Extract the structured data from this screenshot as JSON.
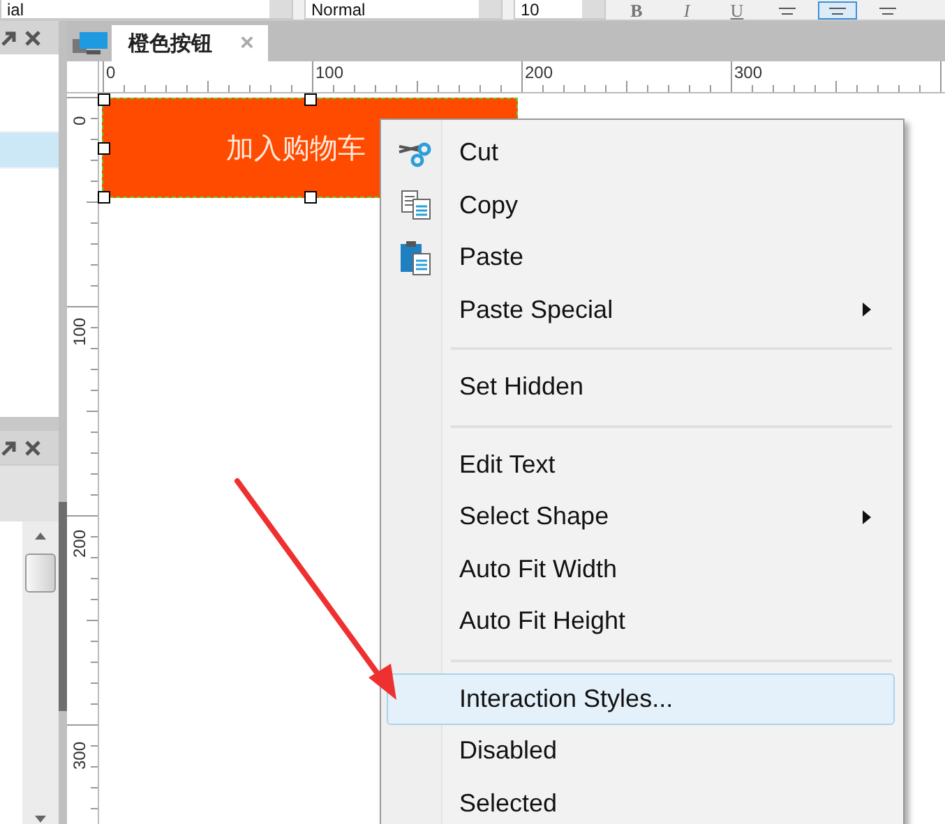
{
  "toolbar": {
    "font_field": "ial",
    "style_field": "Normal",
    "size_field": "10",
    "format_buttons": [
      "B",
      "I",
      "U"
    ],
    "align_buttons": [
      {
        "selected": false
      },
      {
        "selected": true
      },
      {
        "selected": false
      }
    ]
  },
  "left_panel": {
    "rows": [
      {
        "selected": false
      },
      {
        "selected": true
      }
    ]
  },
  "tab": {
    "label": "橙色按钮",
    "close": "×"
  },
  "ruler": {
    "top_labels": [
      "0",
      "100",
      "200",
      "300"
    ],
    "left_labels": [
      "0",
      "100",
      "200",
      "300"
    ]
  },
  "canvas": {
    "button_label": "加入购物车"
  },
  "context_menu": [
    {
      "kind": "cut",
      "label": "Cut",
      "selected": false
    },
    {
      "kind": "copy",
      "label": "Copy",
      "selected": false
    },
    {
      "kind": "paste",
      "label": "Paste",
      "selected": false
    },
    {
      "kind": "submenu",
      "label": "Paste Special",
      "selected": false
    },
    {
      "kind": "separator"
    },
    {
      "kind": "plain",
      "label": "Set Hidden",
      "selected": false
    },
    {
      "kind": "separator"
    },
    {
      "kind": "plain",
      "label": "Edit Text",
      "selected": false
    },
    {
      "kind": "submenu",
      "label": "Select Shape",
      "selected": false
    },
    {
      "kind": "plain",
      "label": "Auto Fit Width",
      "selected": false
    },
    {
      "kind": "plain",
      "label": "Auto Fit Height",
      "selected": false
    },
    {
      "kind": "separator"
    },
    {
      "kind": "plain",
      "label": "Interaction Styles...",
      "selected": true
    },
    {
      "kind": "plain",
      "label": "Disabled",
      "selected": false
    },
    {
      "kind": "plain",
      "label": "Selected",
      "selected": false
    }
  ]
}
